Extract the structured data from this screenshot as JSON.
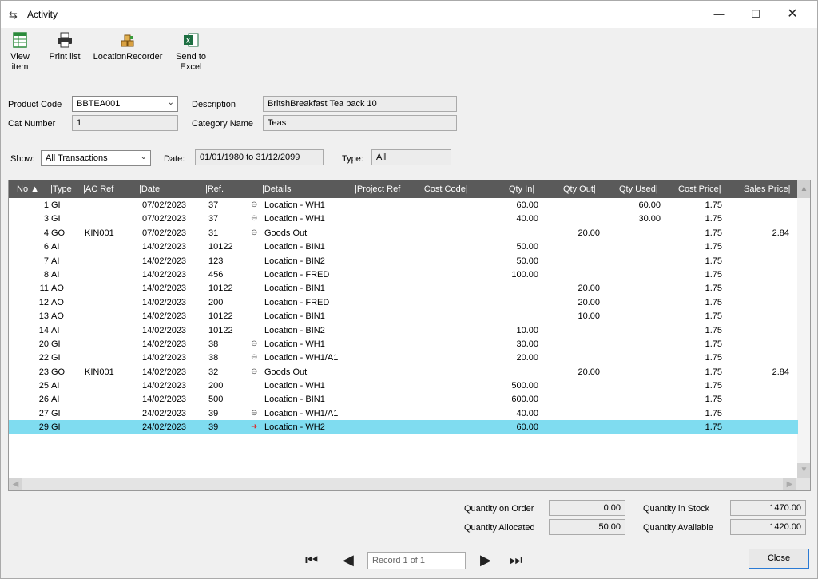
{
  "window": {
    "title": "Activity",
    "controls": {
      "minimize": "—",
      "maximize": "☐",
      "close": "✕"
    }
  },
  "toolbar": {
    "view_item": "View item",
    "print_list": "Print list",
    "location_recorder": "LocationRecorder",
    "send_to_excel": "Send to Excel"
  },
  "product": {
    "product_code_label": "Product Code",
    "product_code": "BBTEA001",
    "description_label": "Description",
    "description": "BritshBreakfast  Tea pack 10",
    "cat_number_label": "Cat Number",
    "cat_number": "1",
    "category_name_label": "Category Name",
    "category_name": "Teas"
  },
  "filters": {
    "show_label": "Show:",
    "show_value": "All Transactions",
    "date_label": "Date:",
    "date_value": "01/01/1980 to 31/12/2099",
    "type_label": "Type:",
    "type_value": "All"
  },
  "grid": {
    "columns": {
      "no": "No",
      "type": "Type",
      "ac_ref": "AC Ref",
      "date": "Date",
      "ref": "Ref.",
      "details": "Details",
      "project_ref": "Project Ref",
      "cost_code": "Cost Code",
      "qty_in": "Qty In",
      "qty_out": "Qty Out",
      "qty_used": "Qty Used",
      "cost_price": "Cost Price",
      "sales_price": "Sales Price"
    },
    "sort_indicator": "▲",
    "rows": [
      {
        "no": "1",
        "type": "GI",
        "ac": "",
        "date": "07/02/2023",
        "ref": "37",
        "icon": "link",
        "details": "Location - WH1",
        "qin": "60.00",
        "qout": "",
        "qused": "60.00",
        "cost": "1.75",
        "sales": ""
      },
      {
        "no": "3",
        "type": "GI",
        "ac": "",
        "date": "07/02/2023",
        "ref": "37",
        "icon": "link",
        "details": "Location - WH1",
        "qin": "40.00",
        "qout": "",
        "qused": "30.00",
        "cost": "1.75",
        "sales": ""
      },
      {
        "no": "4",
        "type": "GO",
        "ac": "KIN001",
        "date": "07/02/2023",
        "ref": "31",
        "icon": "link",
        "details": "Goods Out",
        "qin": "",
        "qout": "20.00",
        "qused": "",
        "cost": "1.75",
        "sales": "2.84"
      },
      {
        "no": "6",
        "type": "AI",
        "ac": "",
        "date": "14/02/2023",
        "ref": "10122",
        "icon": "",
        "details": "Location - BIN1",
        "qin": "50.00",
        "qout": "",
        "qused": "",
        "cost": "1.75",
        "sales": ""
      },
      {
        "no": "7",
        "type": "AI",
        "ac": "",
        "date": "14/02/2023",
        "ref": "123",
        "icon": "",
        "details": "Location - BIN2",
        "qin": "50.00",
        "qout": "",
        "qused": "",
        "cost": "1.75",
        "sales": ""
      },
      {
        "no": "8",
        "type": "AI",
        "ac": "",
        "date": "14/02/2023",
        "ref": "456",
        "icon": "",
        "details": "Location - FRED",
        "qin": "100.00",
        "qout": "",
        "qused": "",
        "cost": "1.75",
        "sales": ""
      },
      {
        "no": "11",
        "type": "AO",
        "ac": "",
        "date": "14/02/2023",
        "ref": "10122",
        "icon": "",
        "details": "Location - BIN1",
        "qin": "",
        "qout": "20.00",
        "qused": "",
        "cost": "1.75",
        "sales": ""
      },
      {
        "no": "12",
        "type": "AO",
        "ac": "",
        "date": "14/02/2023",
        "ref": "200",
        "icon": "",
        "details": "Location - FRED",
        "qin": "",
        "qout": "20.00",
        "qused": "",
        "cost": "1.75",
        "sales": ""
      },
      {
        "no": "13",
        "type": "AO",
        "ac": "",
        "date": "14/02/2023",
        "ref": "10122",
        "icon": "",
        "details": "Location - BIN1",
        "qin": "",
        "qout": "10.00",
        "qused": "",
        "cost": "1.75",
        "sales": ""
      },
      {
        "no": "14",
        "type": "AI",
        "ac": "",
        "date": "14/02/2023",
        "ref": "10122",
        "icon": "",
        "details": "Location - BIN2",
        "qin": "10.00",
        "qout": "",
        "qused": "",
        "cost": "1.75",
        "sales": ""
      },
      {
        "no": "20",
        "type": "GI",
        "ac": "",
        "date": "14/02/2023",
        "ref": "38",
        "icon": "link",
        "details": "Location - WH1",
        "qin": "30.00",
        "qout": "",
        "qused": "",
        "cost": "1.75",
        "sales": ""
      },
      {
        "no": "22",
        "type": "GI",
        "ac": "",
        "date": "14/02/2023",
        "ref": "38",
        "icon": "link",
        "details": "Location - WH1/A1",
        "qin": "20.00",
        "qout": "",
        "qused": "",
        "cost": "1.75",
        "sales": ""
      },
      {
        "no": "23",
        "type": "GO",
        "ac": "KIN001",
        "date": "14/02/2023",
        "ref": "32",
        "icon": "link",
        "details": "Goods Out",
        "qin": "",
        "qout": "20.00",
        "qused": "",
        "cost": "1.75",
        "sales": "2.84"
      },
      {
        "no": "25",
        "type": "AI",
        "ac": "",
        "date": "14/02/2023",
        "ref": "200",
        "icon": "",
        "details": "Location - WH1",
        "qin": "500.00",
        "qout": "",
        "qused": "",
        "cost": "1.75",
        "sales": ""
      },
      {
        "no": "26",
        "type": "AI",
        "ac": "",
        "date": "14/02/2023",
        "ref": "500",
        "icon": "",
        "details": "Location - BIN1",
        "qin": "600.00",
        "qout": "",
        "qused": "",
        "cost": "1.75",
        "sales": ""
      },
      {
        "no": "27",
        "type": "GI",
        "ac": "",
        "date": "24/02/2023",
        "ref": "39",
        "icon": "link",
        "details": "Location - WH1/A1",
        "qin": "40.00",
        "qout": "",
        "qused": "",
        "cost": "1.75",
        "sales": ""
      },
      {
        "no": "29",
        "type": "GI",
        "ac": "",
        "date": "24/02/2023",
        "ref": "39",
        "icon": "arrow-red",
        "details": "Location - WH2",
        "qin": "60.00",
        "qout": "",
        "qused": "",
        "cost": "1.75",
        "sales": "",
        "selected": true
      }
    ]
  },
  "summary": {
    "qty_on_order_label": "Quantity on Order",
    "qty_on_order": "0.00",
    "qty_allocated_label": "Quantity Allocated",
    "qty_allocated": "50.00",
    "qty_in_stock_label": "Quantity in Stock",
    "qty_in_stock": "1470.00",
    "qty_available_label": "Quantity Available",
    "qty_available": "1420.00"
  },
  "navigation": {
    "record_placeholder": "Record 1 of 1",
    "close_label": "Close"
  },
  "colors": {
    "header_bg": "#5a5a5a",
    "selected_row": "#7fdcf0",
    "window_bg": "#f0f0f0"
  }
}
